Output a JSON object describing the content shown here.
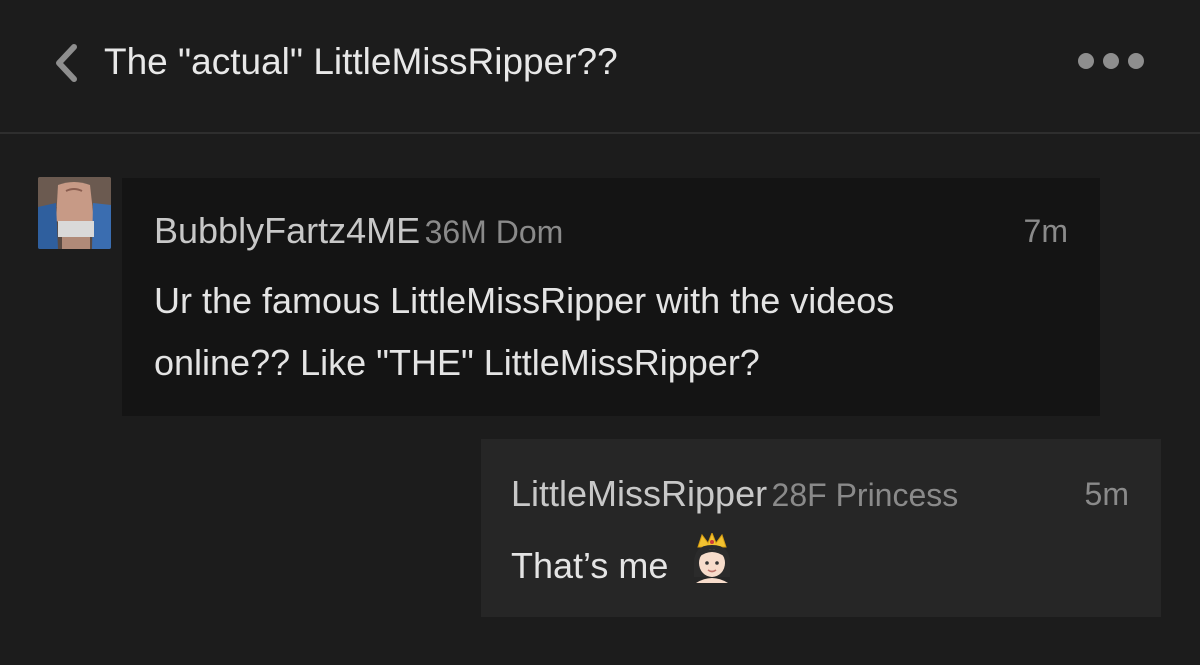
{
  "header": {
    "back_icon": "chevron-left-icon",
    "title": "The \"actual\" LittleMissRipper??",
    "more_icon": "ellipsis-icon"
  },
  "messages": [
    {
      "direction": "received",
      "username": "BubblyFartz4ME",
      "tags": "36M Dom",
      "time": "7m",
      "lines": [
        "Ur the famous LittleMissRipper with the videos",
        "online?? Like \"THE\" LittleMissRipper?"
      ]
    },
    {
      "direction": "sent",
      "username": "LittleMissRipper",
      "tags": "28F Princess",
      "time": "5m",
      "text": "That’s me",
      "emoji": "princess-emoji"
    }
  ],
  "colors": {
    "background": "#1c1c1c",
    "received_bubble": "#141414",
    "sent_bubble": "#262626",
    "primary_text": "#e4e4e4",
    "secondary_text": "#8a8a8a"
  }
}
